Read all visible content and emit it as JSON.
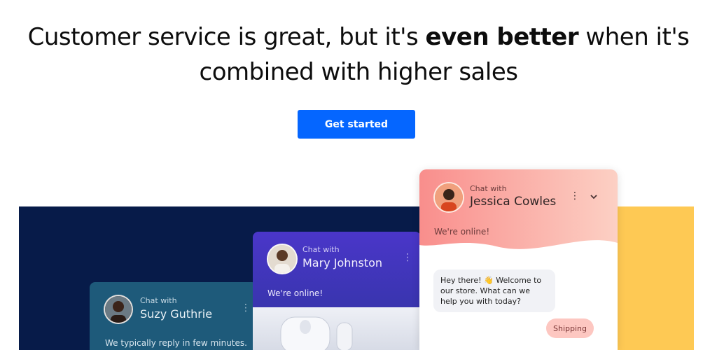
{
  "hero": {
    "headline_part1": "Customer service is great, but it's ",
    "headline_bold": "even better",
    "headline_part2": " when it's combined with higher sales",
    "cta_label": "Get started"
  },
  "widgets": {
    "suzy": {
      "chat_with": "Chat with",
      "agent_name": "Suzy Guthrie",
      "reply_note": "We typically reply in few minutes."
    },
    "mary": {
      "chat_with": "Chat with",
      "agent_name": "Mary Johnston",
      "status": "We're online!"
    },
    "jessica": {
      "chat_with": "Chat with",
      "agent_name": "Jessica Cowles",
      "status": "We're online!",
      "message_before_emoji": "Hey there! ",
      "emoji": "👋",
      "message_after_emoji": " Welcome to our store. What can we help you with today?",
      "quick_reply": "Shipping"
    }
  },
  "colors": {
    "cta": "#0566ff",
    "navy_panel": "#071b49",
    "yellow_panel": "#fec954",
    "jessica_header_start": "#f98e8c",
    "jessica_header_end": "#fcd0c4"
  },
  "icons": [
    "avatar",
    "more-vertical-icon",
    "chevron-down-icon",
    "wave-emoji-icon"
  ]
}
